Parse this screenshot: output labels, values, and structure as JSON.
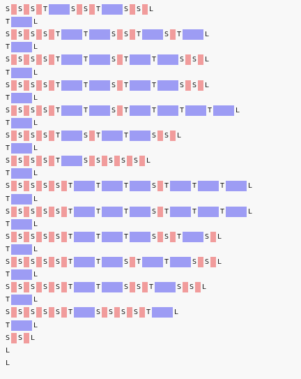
{
  "colors": {
    "background": "#f8f8f8",
    "pink": "#f19c9c",
    "blue": "#9d9cf4",
    "text": "#111111"
  },
  "lines": [
    {
      "tokens": [
        [
          "S",
          "p"
        ],
        [
          "S",
          "p"
        ],
        [
          "S",
          "p"
        ],
        [
          "T",
          "b"
        ],
        [
          "S",
          "p"
        ],
        [
          "S",
          "p"
        ],
        [
          "T",
          "b"
        ],
        [
          "S",
          "p"
        ],
        [
          "S",
          "p"
        ],
        [
          "L",
          ""
        ]
      ]
    },
    {
      "tokens": [
        [
          "T",
          "b"
        ],
        [
          "L",
          ""
        ]
      ]
    },
    {
      "tokens": [
        [
          "S",
          "p"
        ],
        [
          "S",
          "p"
        ],
        [
          "S",
          "p"
        ],
        [
          "S",
          "p"
        ],
        [
          "T",
          "b"
        ],
        [
          "T",
          "b"
        ],
        [
          "S",
          "p"
        ],
        [
          "S",
          "p"
        ],
        [
          "T",
          "b"
        ],
        [
          "S",
          "p"
        ],
        [
          "T",
          "b"
        ],
        [
          "L",
          ""
        ]
      ]
    },
    {
      "tokens": [
        [
          "T",
          "b"
        ],
        [
          "L",
          ""
        ]
      ]
    },
    {
      "tokens": [
        [
          "S",
          "p"
        ],
        [
          "S",
          "p"
        ],
        [
          "S",
          "p"
        ],
        [
          "S",
          "p"
        ],
        [
          "T",
          "b"
        ],
        [
          "T",
          "b"
        ],
        [
          "S",
          "p"
        ],
        [
          "T",
          "b"
        ],
        [
          "T",
          "b"
        ],
        [
          "S",
          "p"
        ],
        [
          "S",
          "p"
        ],
        [
          "L",
          ""
        ]
      ]
    },
    {
      "tokens": [
        [
          "T",
          "b"
        ],
        [
          "L",
          ""
        ]
      ]
    },
    {
      "tokens": [
        [
          "S",
          "p"
        ],
        [
          "S",
          "p"
        ],
        [
          "S",
          "p"
        ],
        [
          "S",
          "p"
        ],
        [
          "T",
          "b"
        ],
        [
          "T",
          "b"
        ],
        [
          "S",
          "p"
        ],
        [
          "T",
          "b"
        ],
        [
          "T",
          "b"
        ],
        [
          "S",
          "p"
        ],
        [
          "S",
          "p"
        ],
        [
          "L",
          ""
        ]
      ]
    },
    {
      "tokens": [
        [
          "T",
          "b"
        ],
        [
          "L",
          ""
        ]
      ]
    },
    {
      "tokens": [
        [
          "S",
          "p"
        ],
        [
          "S",
          "p"
        ],
        [
          "S",
          "p"
        ],
        [
          "S",
          "p"
        ],
        [
          "T",
          "b"
        ],
        [
          "T",
          "b"
        ],
        [
          "S",
          "p"
        ],
        [
          "T",
          "b"
        ],
        [
          "T",
          "b"
        ],
        [
          "T",
          "b"
        ],
        [
          "T",
          "b"
        ],
        [
          "L",
          ""
        ]
      ]
    },
    {
      "tokens": [
        [
          "T",
          "b"
        ],
        [
          "L",
          ""
        ]
      ]
    },
    {
      "tokens": [
        [
          "S",
          "p"
        ],
        [
          "S",
          "p"
        ],
        [
          "S",
          "p"
        ],
        [
          "S",
          "p"
        ],
        [
          "T",
          "b"
        ],
        [
          "S",
          "p"
        ],
        [
          "T",
          "b"
        ],
        [
          "T",
          "b"
        ],
        [
          "S",
          "p"
        ],
        [
          "S",
          "p"
        ],
        [
          "L",
          ""
        ]
      ]
    },
    {
      "tokens": [
        [
          "T",
          "b"
        ],
        [
          "L",
          ""
        ]
      ]
    },
    {
      "tokens": [
        [
          "S",
          "p"
        ],
        [
          "S",
          "p"
        ],
        [
          "S",
          "p"
        ],
        [
          "S",
          "p"
        ],
        [
          "T",
          "b"
        ],
        [
          "S",
          "p"
        ],
        [
          "S",
          "p"
        ],
        [
          "S",
          "p"
        ],
        [
          "S",
          "p"
        ],
        [
          "S",
          "p"
        ],
        [
          "L",
          ""
        ]
      ]
    },
    {
      "tokens": [
        [
          "T",
          "b"
        ],
        [
          "L",
          ""
        ]
      ]
    },
    {
      "tokens": [
        [
          "S",
          "p"
        ],
        [
          "S",
          "p"
        ],
        [
          "S",
          "p"
        ],
        [
          "S",
          "p"
        ],
        [
          "S",
          "p"
        ],
        [
          "T",
          "b"
        ],
        [
          "T",
          "b"
        ],
        [
          "T",
          "b"
        ],
        [
          "S",
          "p"
        ],
        [
          "T",
          "b"
        ],
        [
          "T",
          "b"
        ],
        [
          "T",
          "b"
        ],
        [
          "L",
          ""
        ]
      ]
    },
    {
      "tokens": [
        [
          "T",
          "b"
        ],
        [
          "L",
          ""
        ]
      ]
    },
    {
      "tokens": [
        [
          "S",
          "p"
        ],
        [
          "S",
          "p"
        ],
        [
          "S",
          "p"
        ],
        [
          "S",
          "p"
        ],
        [
          "S",
          "p"
        ],
        [
          "T",
          "b"
        ],
        [
          "T",
          "b"
        ],
        [
          "T",
          "b"
        ],
        [
          "S",
          "p"
        ],
        [
          "T",
          "b"
        ],
        [
          "T",
          "b"
        ],
        [
          "T",
          "b"
        ],
        [
          "L",
          ""
        ]
      ]
    },
    {
      "tokens": [
        [
          "T",
          "b"
        ],
        [
          "L",
          ""
        ]
      ]
    },
    {
      "tokens": [
        [
          "S",
          "p"
        ],
        [
          "S",
          "p"
        ],
        [
          "S",
          "p"
        ],
        [
          "S",
          "p"
        ],
        [
          "S",
          "p"
        ],
        [
          "T",
          "b"
        ],
        [
          "T",
          "b"
        ],
        [
          "T",
          "b"
        ],
        [
          "S",
          "p"
        ],
        [
          "S",
          "p"
        ],
        [
          "T",
          "b"
        ],
        [
          "S",
          "p"
        ],
        [
          "L",
          ""
        ]
      ]
    },
    {
      "tokens": [
        [
          "T",
          "b"
        ],
        [
          "L",
          ""
        ]
      ]
    },
    {
      "tokens": [
        [
          "S",
          "p"
        ],
        [
          "S",
          "p"
        ],
        [
          "S",
          "p"
        ],
        [
          "S",
          "p"
        ],
        [
          "S",
          "p"
        ],
        [
          "T",
          "b"
        ],
        [
          "T",
          "b"
        ],
        [
          "S",
          "p"
        ],
        [
          "T",
          "b"
        ],
        [
          "T",
          "b"
        ],
        [
          "S",
          "p"
        ],
        [
          "S",
          "p"
        ],
        [
          "L",
          ""
        ]
      ]
    },
    {
      "tokens": [
        [
          "T",
          "b"
        ],
        [
          "L",
          ""
        ]
      ]
    },
    {
      "tokens": [
        [
          "S",
          "p"
        ],
        [
          "S",
          "p"
        ],
        [
          "S",
          "p"
        ],
        [
          "S",
          "p"
        ],
        [
          "S",
          "p"
        ],
        [
          "T",
          "b"
        ],
        [
          "T",
          "b"
        ],
        [
          "S",
          "p"
        ],
        [
          "S",
          "p"
        ],
        [
          "T",
          "b"
        ],
        [
          "S",
          "p"
        ],
        [
          "S",
          "p"
        ],
        [
          "L",
          ""
        ]
      ]
    },
    {
      "tokens": [
        [
          "T",
          "b"
        ],
        [
          "L",
          ""
        ]
      ]
    },
    {
      "tokens": [
        [
          "S",
          "p"
        ],
        [
          "S",
          "p"
        ],
        [
          "S",
          "p"
        ],
        [
          "S",
          "p"
        ],
        [
          "S",
          "p"
        ],
        [
          "T",
          "b"
        ],
        [
          "S",
          "p"
        ],
        [
          "S",
          "p"
        ],
        [
          "S",
          "p"
        ],
        [
          "S",
          "p"
        ],
        [
          "T",
          "b"
        ],
        [
          "L",
          ""
        ]
      ]
    },
    {
      "tokens": [
        [
          "T",
          "b"
        ],
        [
          "L",
          ""
        ]
      ]
    },
    {
      "tokens": [
        [
          "S",
          "p"
        ],
        [
          "S",
          "p"
        ],
        [
          "L",
          ""
        ]
      ]
    },
    {
      "tokens": [
        [
          "L",
          ""
        ]
      ]
    },
    {
      "tokens": [
        [
          "L",
          ""
        ]
      ]
    }
  ]
}
